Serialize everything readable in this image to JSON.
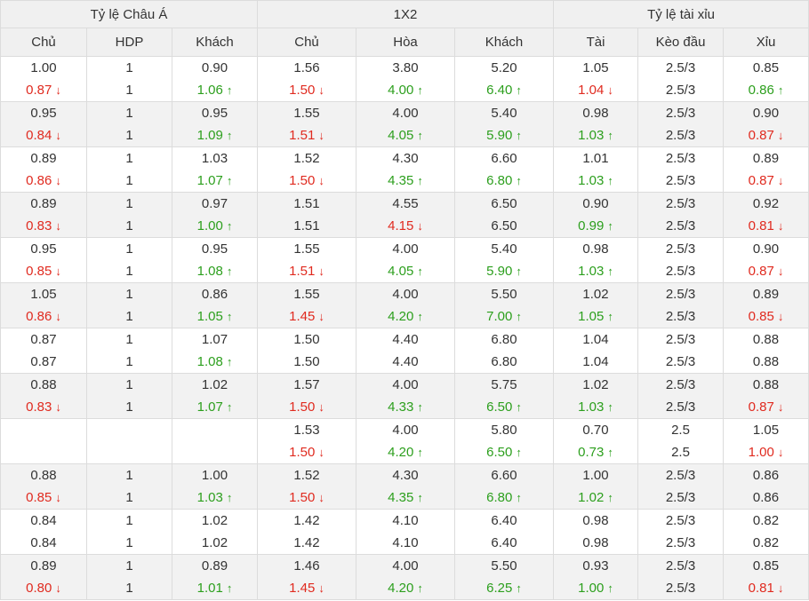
{
  "groups": [
    "Tỷ lệ Châu Á",
    "1X2",
    "Tỷ lệ tài xỉu"
  ],
  "columns": [
    "Chủ",
    "HDP",
    "Khách",
    "Chủ",
    "Hòa",
    "Khách",
    "Tài",
    "Kèo đầu",
    "Xỉu"
  ],
  "arrows": {
    "up": "↑",
    "down": "↓"
  },
  "colors": {
    "up": "#2c9f1d",
    "down": "#e02a1f"
  },
  "rows": [
    [
      [
        "1.00",
        "0.87",
        "d"
      ],
      [
        "1",
        "1",
        ""
      ],
      [
        "0.90",
        "1.06",
        "u"
      ],
      [
        "1.56",
        "1.50",
        "d"
      ],
      [
        "3.80",
        "4.00",
        "u"
      ],
      [
        "5.20",
        "6.40",
        "u"
      ],
      [
        "1.05",
        "1.04",
        "d"
      ],
      [
        "2.5/3",
        "2.5/3",
        ""
      ],
      [
        "0.85",
        "0.86",
        "u"
      ]
    ],
    [
      [
        "0.95",
        "0.84",
        "d"
      ],
      [
        "1",
        "1",
        ""
      ],
      [
        "0.95",
        "1.09",
        "u"
      ],
      [
        "1.55",
        "1.51",
        "d"
      ],
      [
        "4.00",
        "4.05",
        "u"
      ],
      [
        "5.40",
        "5.90",
        "u"
      ],
      [
        "0.98",
        "1.03",
        "u"
      ],
      [
        "2.5/3",
        "2.5/3",
        ""
      ],
      [
        "0.90",
        "0.87",
        "d"
      ]
    ],
    [
      [
        "0.89",
        "0.86",
        "d"
      ],
      [
        "1",
        "1",
        ""
      ],
      [
        "1.03",
        "1.07",
        "u"
      ],
      [
        "1.52",
        "1.50",
        "d"
      ],
      [
        "4.30",
        "4.35",
        "u"
      ],
      [
        "6.60",
        "6.80",
        "u"
      ],
      [
        "1.01",
        "1.03",
        "u"
      ],
      [
        "2.5/3",
        "2.5/3",
        ""
      ],
      [
        "0.89",
        "0.87",
        "d"
      ]
    ],
    [
      [
        "0.89",
        "0.83",
        "d"
      ],
      [
        "1",
        "1",
        ""
      ],
      [
        "0.97",
        "1.00",
        "u"
      ],
      [
        "1.51",
        "1.51",
        ""
      ],
      [
        "4.55",
        "4.15",
        "d"
      ],
      [
        "6.50",
        "6.50",
        ""
      ],
      [
        "0.90",
        "0.99",
        "u"
      ],
      [
        "2.5/3",
        "2.5/3",
        ""
      ],
      [
        "0.92",
        "0.81",
        "d"
      ]
    ],
    [
      [
        "0.95",
        "0.85",
        "d"
      ],
      [
        "1",
        "1",
        ""
      ],
      [
        "0.95",
        "1.08",
        "u"
      ],
      [
        "1.55",
        "1.51",
        "d"
      ],
      [
        "4.00",
        "4.05",
        "u"
      ],
      [
        "5.40",
        "5.90",
        "u"
      ],
      [
        "0.98",
        "1.03",
        "u"
      ],
      [
        "2.5/3",
        "2.5/3",
        ""
      ],
      [
        "0.90",
        "0.87",
        "d"
      ]
    ],
    [
      [
        "1.05",
        "0.86",
        "d"
      ],
      [
        "1",
        "1",
        ""
      ],
      [
        "0.86",
        "1.05",
        "u"
      ],
      [
        "1.55",
        "1.45",
        "d"
      ],
      [
        "4.00",
        "4.20",
        "u"
      ],
      [
        "5.50",
        "7.00",
        "u"
      ],
      [
        "1.02",
        "1.05",
        "u"
      ],
      [
        "2.5/3",
        "2.5/3",
        ""
      ],
      [
        "0.89",
        "0.85",
        "d"
      ]
    ],
    [
      [
        "0.87",
        "0.87",
        ""
      ],
      [
        "1",
        "1",
        ""
      ],
      [
        "1.07",
        "1.08",
        "u"
      ],
      [
        "1.50",
        "1.50",
        ""
      ],
      [
        "4.40",
        "4.40",
        ""
      ],
      [
        "6.80",
        "6.80",
        ""
      ],
      [
        "1.04",
        "1.04",
        ""
      ],
      [
        "2.5/3",
        "2.5/3",
        ""
      ],
      [
        "0.88",
        "0.88",
        ""
      ]
    ],
    [
      [
        "0.88",
        "0.83",
        "d"
      ],
      [
        "1",
        "1",
        ""
      ],
      [
        "1.02",
        "1.07",
        "u"
      ],
      [
        "1.57",
        "1.50",
        "d"
      ],
      [
        "4.00",
        "4.33",
        "u"
      ],
      [
        "5.75",
        "6.50",
        "u"
      ],
      [
        "1.02",
        "1.03",
        "u"
      ],
      [
        "2.5/3",
        "2.5/3",
        ""
      ],
      [
        "0.88",
        "0.87",
        "d"
      ]
    ],
    [
      [
        "",
        "",
        ""
      ],
      [
        "",
        "",
        ""
      ],
      [
        "",
        "",
        ""
      ],
      [
        "1.53",
        "1.50",
        "d"
      ],
      [
        "4.00",
        "4.20",
        "u"
      ],
      [
        "5.80",
        "6.50",
        "u"
      ],
      [
        "0.70",
        "0.73",
        "u"
      ],
      [
        "2.5",
        "2.5",
        ""
      ],
      [
        "1.05",
        "1.00",
        "d"
      ]
    ],
    [
      [
        "0.88",
        "0.85",
        "d"
      ],
      [
        "1",
        "1",
        ""
      ],
      [
        "1.00",
        "1.03",
        "u"
      ],
      [
        "1.52",
        "1.50",
        "d"
      ],
      [
        "4.30",
        "4.35",
        "u"
      ],
      [
        "6.60",
        "6.80",
        "u"
      ],
      [
        "1.00",
        "1.02",
        "u"
      ],
      [
        "2.5/3",
        "2.5/3",
        ""
      ],
      [
        "0.86",
        "0.86",
        ""
      ]
    ],
    [
      [
        "0.84",
        "0.84",
        ""
      ],
      [
        "1",
        "1",
        ""
      ],
      [
        "1.02",
        "1.02",
        ""
      ],
      [
        "1.42",
        "1.42",
        ""
      ],
      [
        "4.10",
        "4.10",
        ""
      ],
      [
        "6.40",
        "6.40",
        ""
      ],
      [
        "0.98",
        "0.98",
        ""
      ],
      [
        "2.5/3",
        "2.5/3",
        ""
      ],
      [
        "0.82",
        "0.82",
        ""
      ]
    ],
    [
      [
        "0.89",
        "0.80",
        "d"
      ],
      [
        "1",
        "1",
        ""
      ],
      [
        "0.89",
        "1.01",
        "u"
      ],
      [
        "1.46",
        "1.45",
        "d"
      ],
      [
        "4.00",
        "4.20",
        "u"
      ],
      [
        "5.50",
        "6.25",
        "u"
      ],
      [
        "0.93",
        "1.00",
        "u"
      ],
      [
        "2.5/3",
        "2.5/3",
        ""
      ],
      [
        "0.85",
        "0.81",
        "d"
      ]
    ]
  ]
}
